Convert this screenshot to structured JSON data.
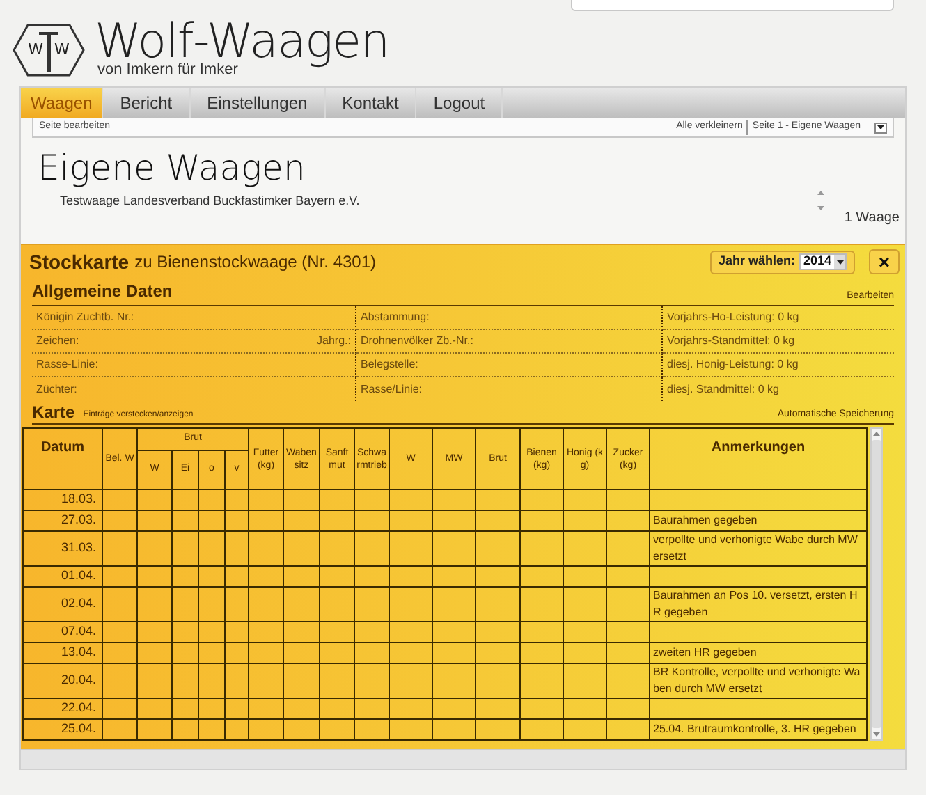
{
  "header": {
    "logo_letters": [
      "W",
      "W"
    ],
    "title": "Wolf-Waagen",
    "tagline": "von Imkern für Imker"
  },
  "nav": [
    {
      "label": "Waagen",
      "selected": true
    },
    {
      "label": "Bericht",
      "selected": false
    },
    {
      "label": "Einstellungen",
      "selected": false
    },
    {
      "label": "Kontakt",
      "selected": false
    },
    {
      "label": "Logout",
      "selected": false
    }
  ],
  "subbar": {
    "edit_link": "Seite bearbeiten",
    "collapse_all": "Alle verkleinern",
    "page_select": "Seite 1 - Eigene Waagen"
  },
  "page_title": "Eigene Waagen",
  "scale_name": "Testwaage Landesverband Buckfastimker Bayern e.V.",
  "scale_count": "1 Waage",
  "card": {
    "title": "Stockkarte",
    "subtitle": "zu Bienenstockwaage (Nr. 4301)",
    "year_label": "Jahr wählen:",
    "year": "2014",
    "close": "×",
    "general": {
      "heading": "Allgemeine Daten",
      "edit": "Bearbeiten",
      "rows": [
        [
          "Königin Zuchtb. Nr.:",
          "Abstammung:",
          "Vorjahrs-Ho-Leistung: 0 kg"
        ],
        [
          "Zeichen:",
          "Drohnenvölker Zb.-Nr.:",
          "Vorjahrs-Standmittel: 0 kg"
        ],
        [
          "Rasse-Linie:",
          "Belegstelle:",
          "diesj. Honig-Leistung: 0 kg"
        ],
        [
          "Züchter:",
          "Rasse/Linie:",
          "diesj. Standmittel: 0 kg"
        ]
      ],
      "year_field": "Jahrg.:"
    },
    "karte": {
      "heading": "Karte",
      "toggle": "Einträge verstecken/anzeigen",
      "autosave": "Automatische Speicherung",
      "columns": [
        {
          "label": "Datum"
        },
        {
          "label": "Bel. W"
        },
        {
          "label": "Brut",
          "children": [
            {
              "label": "W"
            },
            {
              "label": "Ei"
            },
            {
              "label": "o"
            },
            {
              "label": "v"
            }
          ]
        },
        {
          "label": "Futter (kg)"
        },
        {
          "label": "Waben sitz"
        },
        {
          "label": "Sanftmut"
        },
        {
          "label": "Schwarmtrieb"
        },
        {
          "label": "W"
        },
        {
          "label": "MW"
        },
        {
          "label": "Brut"
        },
        {
          "label": "Bienen (kg)"
        },
        {
          "label": "Honig (kg)"
        },
        {
          "label": "Zucker (kg)"
        },
        {
          "label": "Anmerkungen"
        }
      ],
      "rows": [
        {
          "date": "18.03."
        },
        {
          "date": "27.03.",
          "note": "Baurahmen gegeben"
        },
        {
          "date": "31.03.",
          "note": "verpollte und verhonigte Wabe durch MW ersetzt"
        },
        {
          "date": "01.04."
        },
        {
          "date": "02.04.",
          "note": "Baurahmen an Pos 10. versetzt, ersten HR gegeben"
        },
        {
          "date": "07.04."
        },
        {
          "date": "13.04.",
          "note": "zweiten HR gegeben"
        },
        {
          "date": "20.04.",
          "note": "BR Kontrolle, verpollte und verhonigte Waben durch MW ersetzt"
        },
        {
          "date": "22.04."
        },
        {
          "date": "25.04.",
          "note": "25.04. Brutraumkontrolle, 3. HR gegeben"
        }
      ]
    }
  }
}
